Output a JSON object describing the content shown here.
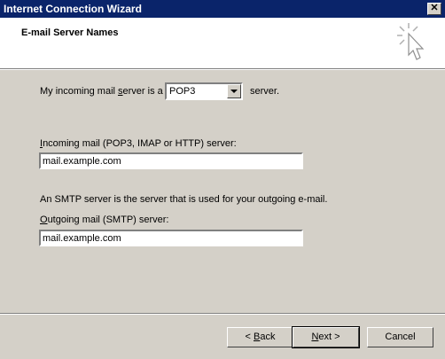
{
  "window": {
    "title": "Internet Connection Wizard",
    "close_glyph": "✕"
  },
  "header": {
    "title": "E-mail Server Names",
    "icon": "cursor-sparkle-icon"
  },
  "form": {
    "incoming_type_prefix": "My incoming mail ",
    "incoming_type_accel": "s",
    "incoming_type_suffix": "erver is a",
    "incoming_type_value": "POP3",
    "incoming_type_after": "server.",
    "incoming_label_accel": "I",
    "incoming_label_rest": "ncoming mail (POP3, IMAP or HTTP) server:",
    "incoming_value": "mail.example.com",
    "smtp_note": "An SMTP server is the server that is used for your outgoing e-mail.",
    "outgoing_label_accel": "O",
    "outgoing_label_rest": "utgoing mail (SMTP) server:",
    "outgoing_value": "mail.example.com"
  },
  "buttons": {
    "back_prefix": "< ",
    "back_accel": "B",
    "back_rest": "ack",
    "next_accel": "N",
    "next_rest": "ext >",
    "cancel": "Cancel"
  }
}
